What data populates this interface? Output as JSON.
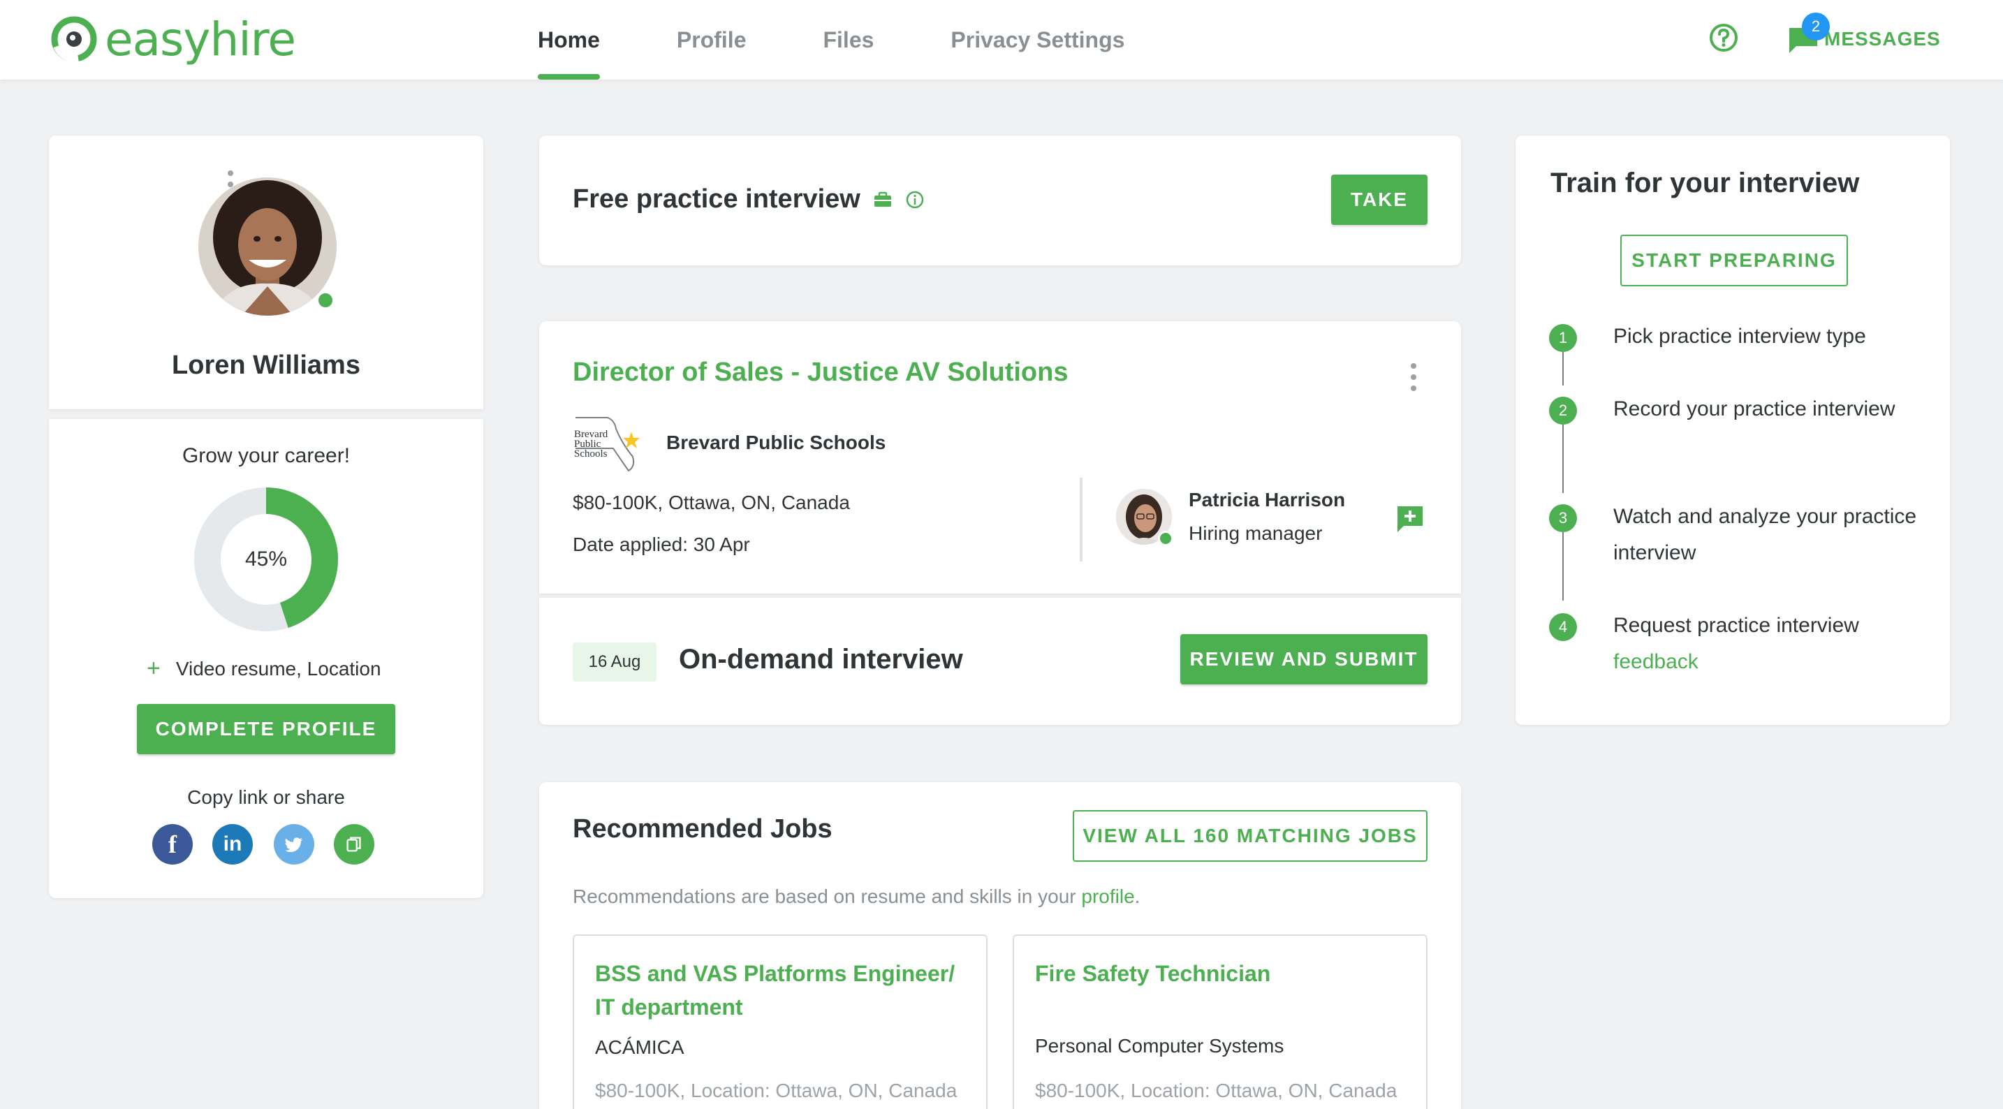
{
  "app": {
    "logo_text": "easyhire"
  },
  "nav": {
    "items": [
      {
        "label": "Home",
        "active": true
      },
      {
        "label": "Profile",
        "active": false
      },
      {
        "label": "Files",
        "active": false
      },
      {
        "label": "Privacy Settings",
        "active": false
      }
    ],
    "help_icon": "help-circle-icon",
    "messages": {
      "label": "MESSAGES",
      "badge": "2",
      "icon": "chat-bubble-icon"
    }
  },
  "profile": {
    "name": "Loren Williams",
    "grow_label": "Grow your career!",
    "completion_percent": 45,
    "completion_label": "45%",
    "missing_label": "Video resume, Location",
    "complete_button": "COMPLETE PROFILE",
    "share_label": "Copy link or share",
    "social": [
      "facebook-icon",
      "linkedin-icon",
      "twitter-icon",
      "copy-icon"
    ]
  },
  "practice": {
    "title": "Free practice interview",
    "take_button": "TAKE"
  },
  "job": {
    "title": "Director of Sales - Justice AV Solutions",
    "company_logo_text": [
      "Brevard",
      "Public",
      "Schools"
    ],
    "company": "Brevard Public Schools",
    "salary_location": "$80-100K, Ottawa, ON, Canada",
    "date_applied": "Date applied: 30 Apr",
    "hiring_manager": {
      "name": "Patricia Harrison",
      "role": "Hiring manager"
    },
    "interview": {
      "date": "16 Aug",
      "type": "On-demand interview",
      "button": "REVIEW AND SUBMIT"
    }
  },
  "recommended": {
    "title": "Recommended Jobs",
    "view_all_button": "VIEW ALL 160 MATCHING JOBS",
    "note_prefix": "Recommendations are based on resume and skills in your ",
    "note_link": "profile",
    "note_suffix": ".",
    "jobs": [
      {
        "title": "BSS and VAS Platforms Engineer/ IT department",
        "company": "ACÁMICA",
        "meta": "$80-100K, Location: Ottawa, ON, Canada"
      },
      {
        "title": "Fire Safety Technician",
        "company": "Personal Computer Systems",
        "meta": "$80-100K, Location: Ottawa, ON, Canada"
      }
    ]
  },
  "train": {
    "title": "Train for your interview",
    "start_button": "START PREPARING",
    "steps": [
      {
        "num": "1",
        "text": "Pick practice interview type"
      },
      {
        "num": "2",
        "text": "Record your practice interview"
      },
      {
        "num": "3",
        "text": "Watch and analyze your practice interview"
      },
      {
        "num": "4",
        "text": "Request practice interview ",
        "link": "feedback"
      }
    ]
  },
  "colors": {
    "brand_green": "#4caf50",
    "badge_blue": "#2196f3",
    "background": "#f0f1f2"
  }
}
